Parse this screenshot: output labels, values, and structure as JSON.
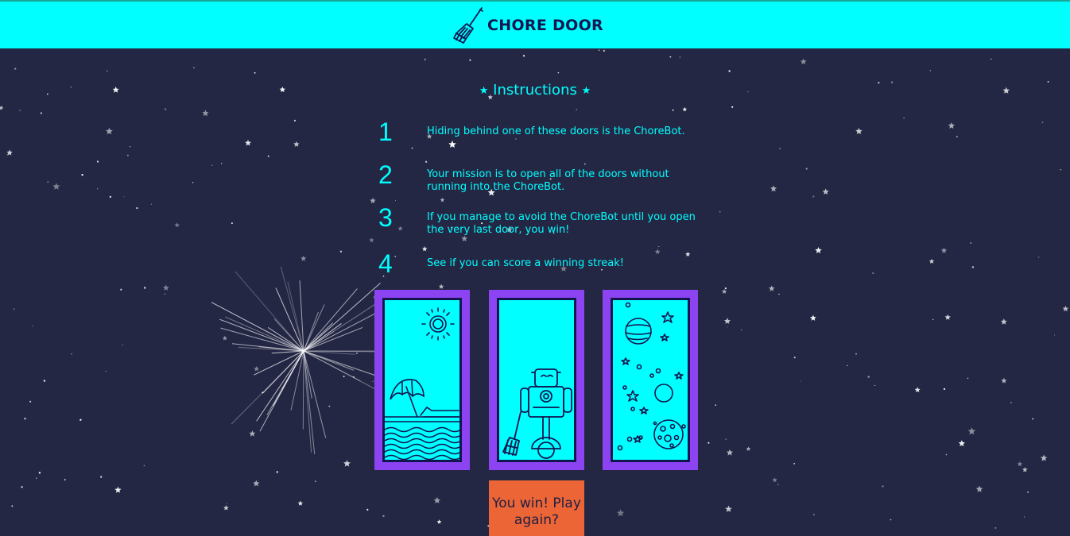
{
  "header": {
    "title": "CHORE DOOR",
    "logo_icon": "broom-icon",
    "background": "#00ffff"
  },
  "instructions": {
    "title": "Instructions",
    "star_icon": "star-icon",
    "items": [
      {
        "number": "1",
        "text": "Hiding behind one of these doors is the ChoreBot."
      },
      {
        "number": "2",
        "text": "Your mission is to open all of the doors without running into the ChoreBot."
      },
      {
        "number": "3",
        "text": "If you manage to avoid the ChoreBot until you open the very last door, you win!"
      },
      {
        "number": "4",
        "text": "See if you can score a winning streak!"
      }
    ]
  },
  "doors": [
    {
      "content": "beach-door-icon"
    },
    {
      "content": "robot-door-icon"
    },
    {
      "content": "space-door-icon"
    }
  ],
  "start_button": {
    "label": "You win! Play again?",
    "color": "#eb6536"
  },
  "colors": {
    "background": "#242744",
    "accent": "#00ffff",
    "door_frame": "#8c44f2",
    "line": "#131550"
  }
}
